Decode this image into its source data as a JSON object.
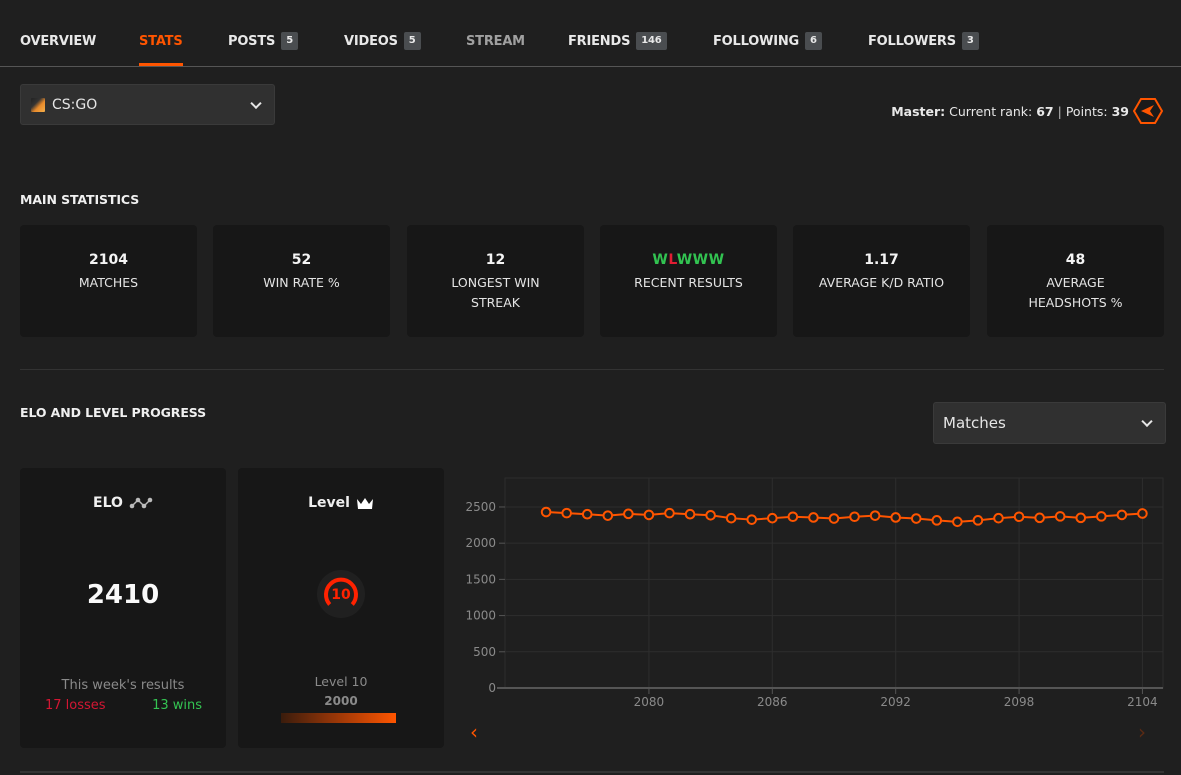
{
  "nav": {
    "items": [
      {
        "label": "OVERVIEW",
        "badge": null,
        "state": "normal"
      },
      {
        "label": "STATS",
        "badge": null,
        "state": "active"
      },
      {
        "label": "POSTS",
        "badge": "5",
        "state": "normal"
      },
      {
        "label": "VIDEOS",
        "badge": "5",
        "state": "normal"
      },
      {
        "label": "STREAM",
        "badge": null,
        "state": "muted"
      },
      {
        "label": "FRIENDS",
        "badge": "146",
        "state": "normal"
      },
      {
        "label": "FOLLOWING",
        "badge": "6",
        "state": "normal"
      },
      {
        "label": "FOLLOWERS",
        "badge": "3",
        "state": "normal"
      }
    ]
  },
  "game_select": {
    "value": "CS:GO",
    "icon": "csgo-game-icon"
  },
  "rank": {
    "tier": "Master:",
    "rank_label": "Current rank:",
    "rank_value": "67",
    "separator": "|",
    "points_label": "Points:",
    "points_value": "39",
    "icon": "rank-emblem-icon"
  },
  "main_statistics": {
    "title": "MAIN STATISTICS",
    "cards": [
      {
        "value": "2104",
        "label": "MATCHES"
      },
      {
        "value": "52",
        "label": "WIN RATE %"
      },
      {
        "value": "12",
        "label": "LONGEST WIN STREAK"
      },
      {
        "value": "WLWWW",
        "label": "RECENT RESULTS"
      },
      {
        "value": "1.17",
        "label": "AVERAGE K/D RATIO"
      },
      {
        "value": "48",
        "label": "AVERAGE HEADSHOTS %"
      }
    ],
    "recent_results": [
      "W",
      "L",
      "W",
      "W",
      "W"
    ]
  },
  "progress": {
    "title": "ELO AND LEVEL PROGRESS",
    "range_select": "Matches",
    "elo": {
      "title": "ELO",
      "value": "2410",
      "week_label": "This week's results",
      "losses": "17 losses",
      "wins": "13 wins"
    },
    "level": {
      "title": "Level",
      "badge": "10",
      "name": "Level 10",
      "points": "2000",
      "progress": 1.0
    }
  },
  "colors": {
    "accent": "#ff5500",
    "win": "#32c351",
    "loss": "#e11d33",
    "background": "#1f1f1f",
    "card": "#171717"
  },
  "chart_data": {
    "type": "line",
    "title": "",
    "xlabel": "",
    "ylabel": "",
    "x": [
      2075,
      2076,
      2077,
      2078,
      2079,
      2080,
      2081,
      2082,
      2083,
      2084,
      2085,
      2086,
      2087,
      2088,
      2089,
      2090,
      2091,
      2092,
      2093,
      2094,
      2095,
      2096,
      2097,
      2098,
      2099,
      2100,
      2101,
      2102,
      2103,
      2104
    ],
    "series": [
      {
        "name": "ELO",
        "values": [
          2430,
          2415,
          2400,
          2380,
          2405,
          2390,
          2415,
          2400,
          2385,
          2345,
          2325,
          2345,
          2365,
          2355,
          2340,
          2365,
          2380,
          2355,
          2340,
          2315,
          2295,
          2315,
          2345,
          2365,
          2350,
          2370,
          2350,
          2370,
          2390,
          2410
        ]
      }
    ],
    "x_ticks": [
      "2080",
      "2086",
      "2092",
      "2098",
      "2104"
    ],
    "y_ticks": [
      "0",
      "500",
      "1000",
      "1500",
      "2000",
      "2500"
    ],
    "xlim": [
      2073,
      2105
    ],
    "ylim": [
      0,
      2900
    ],
    "grid": true,
    "legend": "none"
  },
  "pager": {
    "prev": "‹",
    "next": "›"
  }
}
